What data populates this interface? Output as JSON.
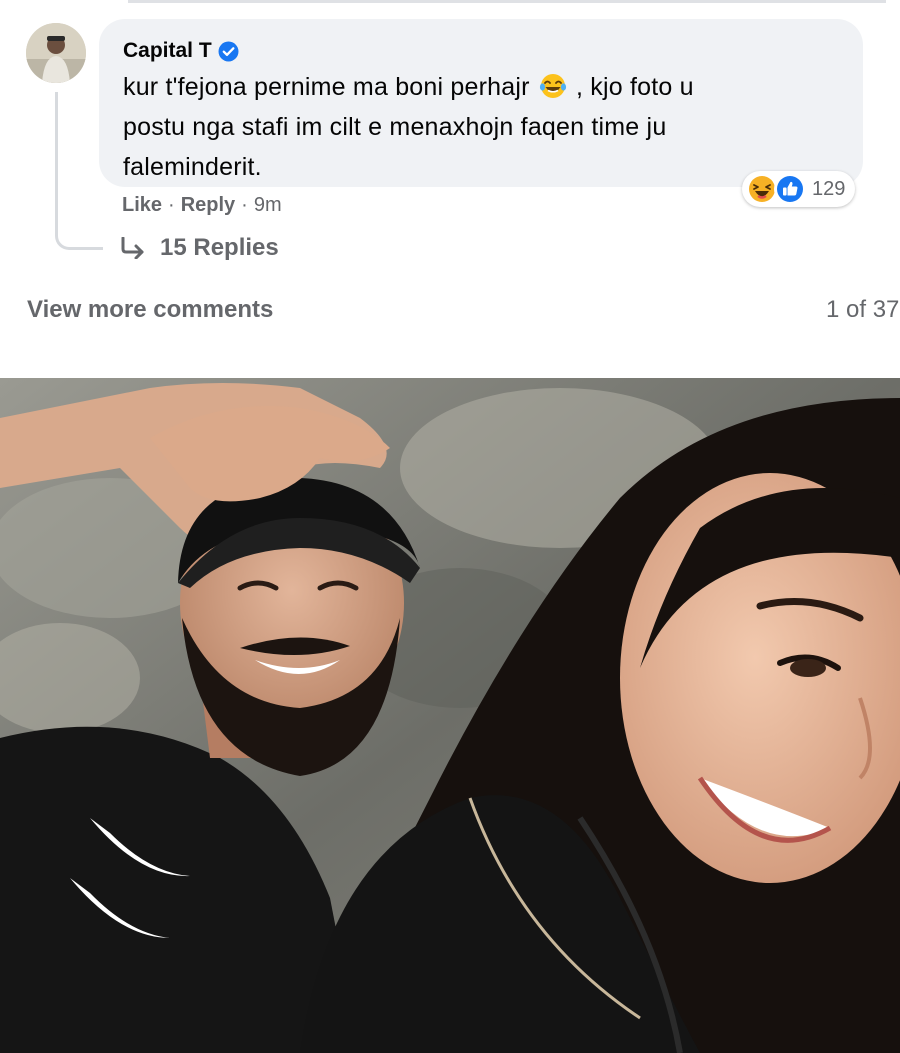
{
  "comment": {
    "author": "Capital T",
    "verified": true,
    "text_line1": "kur t'fejona pernime ma boni perhajr",
    "text_line1_tail": ", kjo foto u",
    "text_line2": "postu nga stafi im cilt e menaxhojn faqen time ju",
    "text_line3": "faleminderit.",
    "reaction_count": "129",
    "like_label": "Like",
    "reply_label": "Reply",
    "separator": "·",
    "time": "9m",
    "replies_label": "15 Replies"
  },
  "footer": {
    "view_more_label": "View more comments",
    "pager_text": "1 of 37"
  },
  "icons": {
    "verified": "verified-badge-icon",
    "inline_emoji": "laughing-crying-emoji-icon",
    "reaction_haha": "haha-reaction-icon",
    "reaction_like": "like-reaction-icon",
    "reply_arrow": "reply-arrow-icon"
  },
  "colors": {
    "bubble": "#f0f2f5",
    "verified": "#1877f2",
    "meta_text": "#65676b",
    "text": "#050505"
  }
}
